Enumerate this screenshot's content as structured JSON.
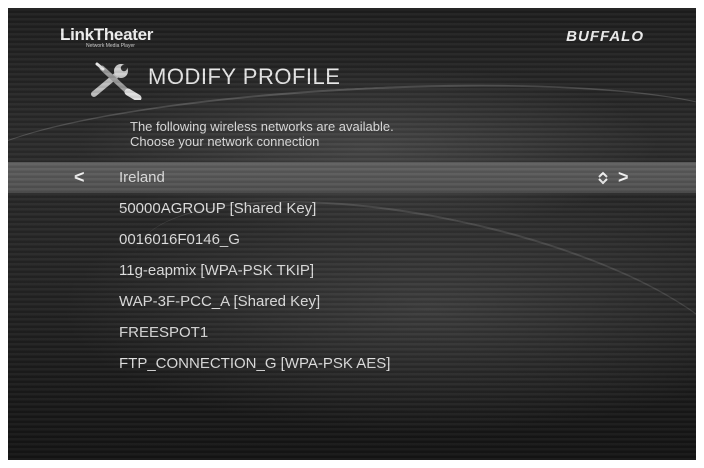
{
  "header": {
    "brand_title": "LinkTheater",
    "brand_subtitle": "Network Media Player",
    "vendor_logo": "BUFFALO"
  },
  "page": {
    "icon": "tools-icon",
    "title": "MODIFY PROFILE",
    "instruction_line1": "The following wireless networks are available.",
    "instruction_line2": "Choose your network connection"
  },
  "networks": {
    "selected": "Ireland",
    "items": [
      "50000AGROUP [Shared Key]",
      "0016016F0146_G",
      "11g-eapmix [WPA-PSK TKIP]",
      "WAP-3F-PCC_A [Shared Key]",
      "FREESPOT1",
      "FTP_CONNECTION_G [WPA-PSK AES]"
    ],
    "left_arrow": "<",
    "right_arrow": ">"
  }
}
